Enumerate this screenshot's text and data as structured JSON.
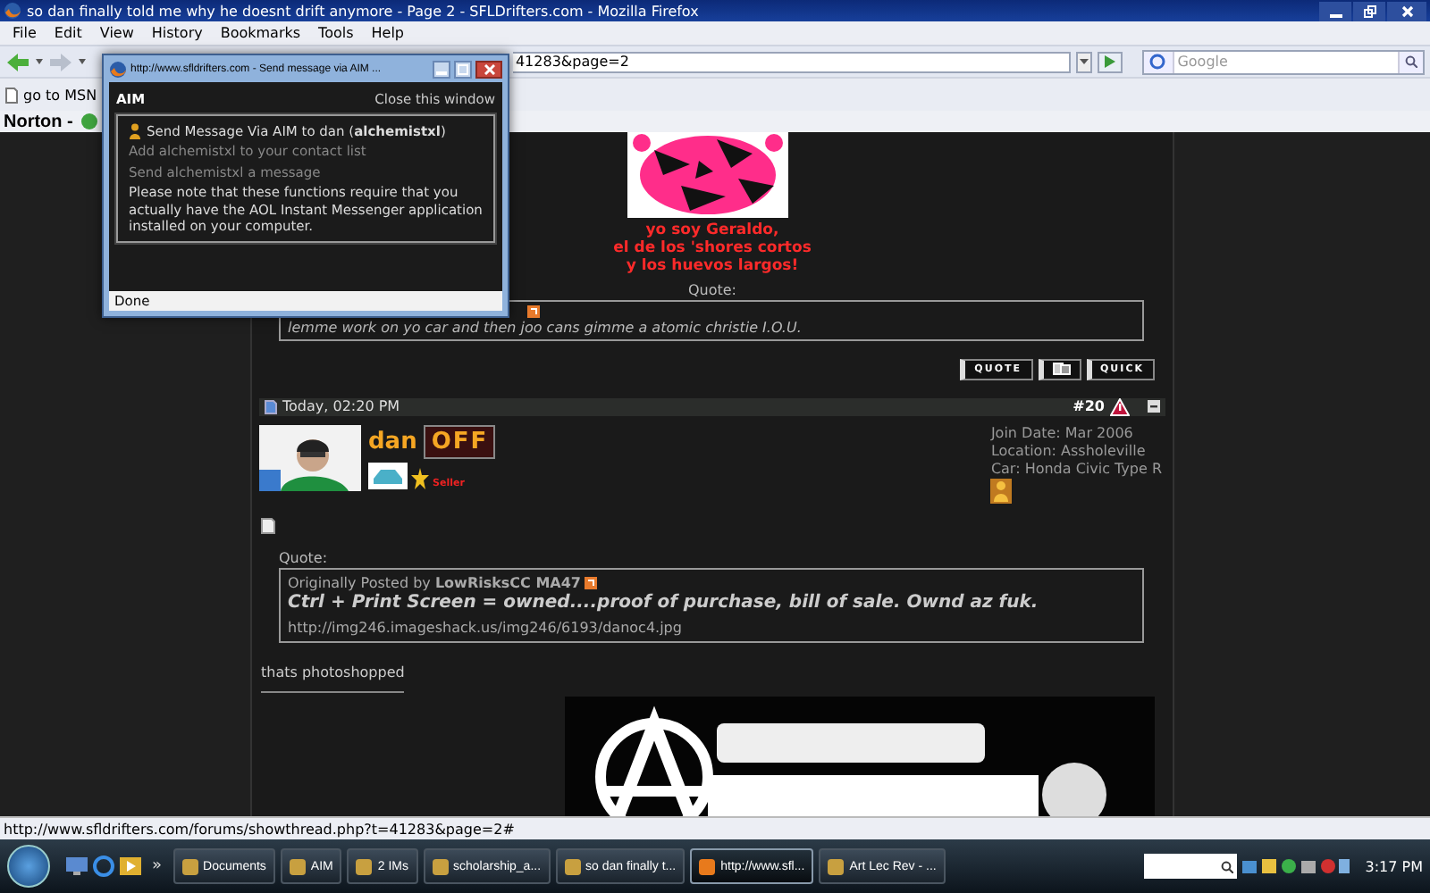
{
  "window": {
    "title": "so dan finally told me why he doesnt drift anymore - Page 2 - SFLDrifters.com - Mozilla Firefox"
  },
  "menu": [
    "File",
    "Edit",
    "View",
    "History",
    "Bookmarks",
    "Tools",
    "Help"
  ],
  "address_bar": {
    "value": "41283&page=2"
  },
  "search": {
    "placeholder": "Google"
  },
  "bookmarks": [
    "go to MSN"
  ],
  "norton": {
    "label": "Norton -"
  },
  "popup": {
    "title": "http://www.sfldrifters.com - Send message via AIM ...",
    "header": "AIM",
    "close_link": "Close this window",
    "send_line": "Send Message Via AIM to dan (**alchemistxl**)",
    "links": [
      "Add alchemistxl to your contact list",
      "Send alchemistxl a message"
    ],
    "note": "Please note that these functions require that you actually have the AOL Instant Messenger application installed on your computer.",
    "status": "Done"
  },
  "previous_post": {
    "caption_lines": [
      "yo soy Geraldo,",
      "el de los 'shores cortos",
      "y los huevos largos!"
    ],
    "quote_label": "Quote:",
    "quote_text": "lemme work on yo car and then joo cans gimme a atomic christie I.O.U.",
    "buttons": [
      {
        "kind": "text",
        "label": "QUOTE"
      },
      {
        "kind": "icon"
      },
      {
        "kind": "text",
        "label": "QUICK"
      }
    ]
  },
  "post": {
    "date": "Today, 02:20 PM",
    "number": "#20",
    "username": "dan",
    "status_badge": "OFF",
    "rank": "Seller",
    "join_date": "Join Date: Mar 2006",
    "location": "Location: Assholeville",
    "car": "Car: Honda Civic Type R",
    "quote_label": "Quote:",
    "quote_author": "Originally Posted by **LowRisksCC MA47**",
    "quote_text": "Ctrl + Print Screen = owned....proof of purchase, bill of sale. Ownd az fuk.",
    "quote_link": "http://img246.imageshack.us/img246/6193/danoc4.jpg",
    "message": "thats photoshopped"
  },
  "status_bar": "http://www.sfldrifters.com/forums/showthread.php?t=41283&page=2#",
  "taskbar": {
    "overflow": "»",
    "items": [
      {
        "label": "Documents",
        "selected": false
      },
      {
        "label": "AIM",
        "selected": false
      },
      {
        "label": "2 IMs",
        "selected": false
      },
      {
        "label": "scholarship_a...",
        "selected": false
      },
      {
        "label": "so dan finally t...",
        "selected": false
      },
      {
        "label": "http://www.sfl...",
        "selected": true
      },
      {
        "label": "Art Lec Rev - ...",
        "selected": false
      }
    ],
    "clock": "3:17 PM"
  }
}
